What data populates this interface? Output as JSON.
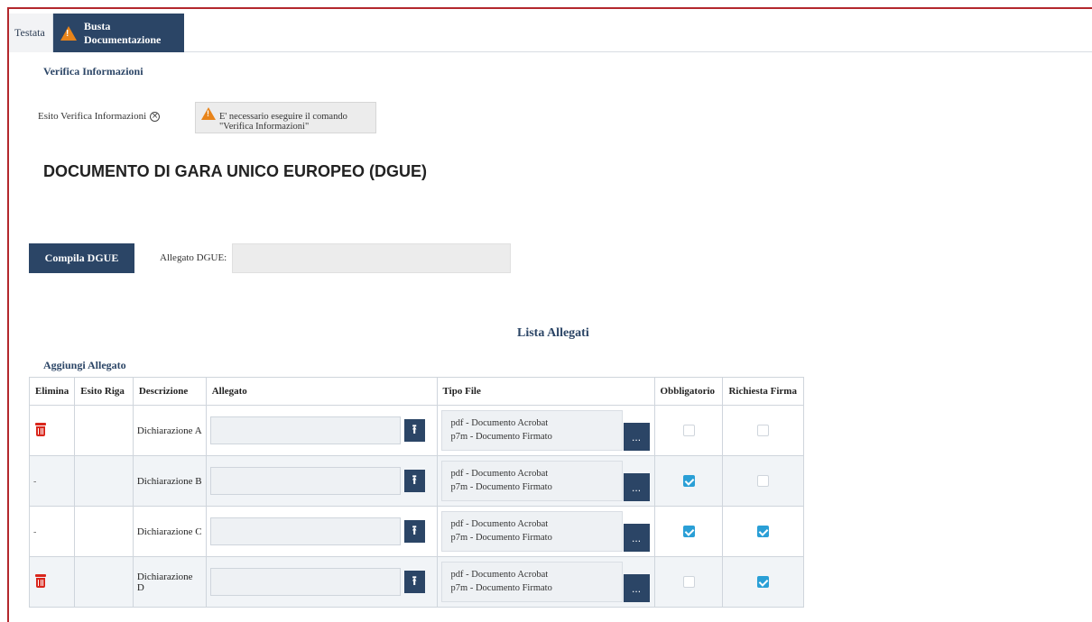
{
  "tabs": [
    {
      "label": "Testata"
    },
    {
      "label": "Busta Documentazione"
    }
  ],
  "verifica": {
    "title": "Verifica Informazioni",
    "esito_label": "Esito Verifica Informazioni",
    "message_line1": "E' necessario eseguire il comando",
    "message_line2": "\"Verifica Informazioni\""
  },
  "dgue": {
    "title": "DOCUMENTO DI GARA UNICO EUROPEO (DGUE)",
    "button": "Compila DGUE",
    "allegato_label": "Allegato DGUE:",
    "allegato_value": ""
  },
  "lista": {
    "title": "Lista Allegati",
    "add_link": "Aggiungi Allegato",
    "columns": [
      "Elimina",
      "Esito Riga",
      "Descrizione",
      "Allegato",
      "Tipo File",
      "Obbligatorio",
      "Richiesta Firma"
    ],
    "rows": [
      {
        "elimina": "trash",
        "descrizione": "Dichiarazione A",
        "tipo1": "pdf - Documento Acrobat",
        "tipo2": "p7m - Documento Firmato",
        "obbligatorio": false,
        "firma": false
      },
      {
        "elimina": "-",
        "descrizione": "Dichiarazione B",
        "tipo1": "pdf - Documento Acrobat",
        "tipo2": "p7m - Documento Firmato",
        "obbligatorio": true,
        "firma": false
      },
      {
        "elimina": "-",
        "descrizione": "Dichiarazione C",
        "tipo1": "pdf - Documento Acrobat",
        "tipo2": "p7m - Documento Firmato",
        "obbligatorio": true,
        "firma": true
      },
      {
        "elimina": "trash",
        "descrizione": "Dichiarazione D",
        "tipo1": "pdf - Documento Acrobat",
        "tipo2": "p7m - Documento Firmato",
        "obbligatorio": false,
        "firma": true
      }
    ],
    "more_button": "..."
  },
  "colors": {
    "primary": "#2b4566",
    "accent_check": "#2a9fd6",
    "warning": "#e8841a",
    "delete": "#d9261c",
    "frame": "#b3282d"
  }
}
